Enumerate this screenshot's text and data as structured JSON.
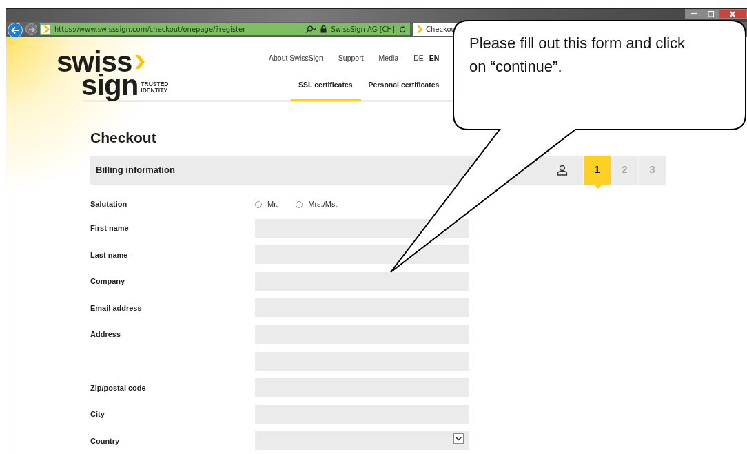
{
  "browser": {
    "url": "https://www.swisssign.com/checkout/onepage/?register",
    "site_identity": "SwissSign AG [CH]",
    "tab_title": "Checkou"
  },
  "logo": {
    "line_1": "swiss",
    "line_2": "sign",
    "tagline_1": "TRUSTED",
    "tagline_2": "IDENTITY"
  },
  "top_links": [
    {
      "label": "About SwissSign"
    },
    {
      "label": "Support"
    },
    {
      "label": "Media"
    }
  ],
  "languages": [
    {
      "label": "DE",
      "selected": false
    },
    {
      "label": "EN",
      "selected": true
    }
  ],
  "main_nav": [
    {
      "label": "SSL certificates",
      "selected": true
    },
    {
      "label": "Personal certificates",
      "selected": false
    }
  ],
  "heading": "Checkout",
  "section": {
    "title": "Billing information",
    "steps": [
      {
        "label": "1",
        "selected": true
      },
      {
        "label": "2",
        "selected": false
      },
      {
        "label": "3",
        "selected": false
      }
    ]
  },
  "form": {
    "salutation": {
      "label": "Salutation",
      "options": [
        {
          "label": "Mr.",
          "selected": false
        },
        {
          "label": "Mrs./Ms.",
          "selected": false
        }
      ]
    },
    "fields": [
      {
        "label": "First name",
        "kind": "text"
      },
      {
        "label": "Last name",
        "kind": "text"
      },
      {
        "label": "Company",
        "kind": "text"
      },
      {
        "label": "Email address",
        "kind": "text"
      },
      {
        "label": "Address",
        "kind": "text"
      },
      {
        "kind": "text"
      },
      {
        "label": "Zip/postal code",
        "kind": "text"
      },
      {
        "label": "City",
        "kind": "text"
      },
      {
        "label": "Country",
        "kind": "select"
      }
    ]
  },
  "callout": {
    "text": "Please fill out this form and click on “continue”."
  }
}
